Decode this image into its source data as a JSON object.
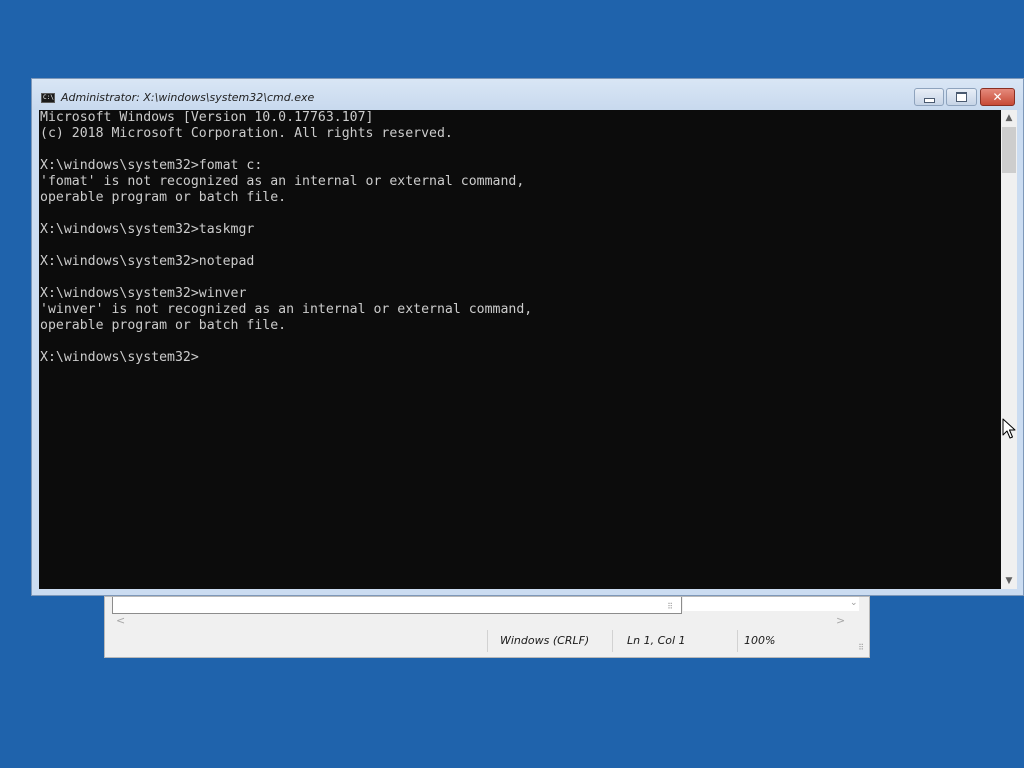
{
  "colors": {
    "desktop": "#1f63ac",
    "console_bg": "#0c0c0c",
    "console_fg": "#cccccc",
    "close_button": "#c74a36"
  },
  "cmd_window": {
    "title": "Administrator: X:\\windows\\system32\\cmd.exe",
    "icon": "command-prompt-icon",
    "icon_text": "C:\\",
    "buttons": {
      "minimize": "minimize-icon",
      "maximize": "maximize-icon",
      "close": "✕"
    },
    "console_lines": [
      "Microsoft Windows [Version 10.0.17763.107]",
      "(c) 2018 Microsoft Corporation. All rights reserved.",
      "",
      "X:\\windows\\system32>fomat c:",
      "'fomat' is not recognized as an internal or external command,",
      "operable program or batch file.",
      "",
      "X:\\windows\\system32>taskmgr",
      "",
      "X:\\windows\\system32>notepad",
      "",
      "X:\\windows\\system32>winver",
      "'winver' is not recognized as an internal or external command,",
      "operable program or batch file.",
      "",
      "X:\\windows\\system32>"
    ],
    "scrollbar": {
      "up": "▲",
      "down": "▼"
    }
  },
  "notepad_window": {
    "status_bar": {
      "encoding": "Windows (CRLF)",
      "position": "Ln 1, Col 1",
      "zoom": "100%"
    },
    "scroll": {
      "left": "<",
      "right": ">",
      "down": "⌄"
    }
  }
}
